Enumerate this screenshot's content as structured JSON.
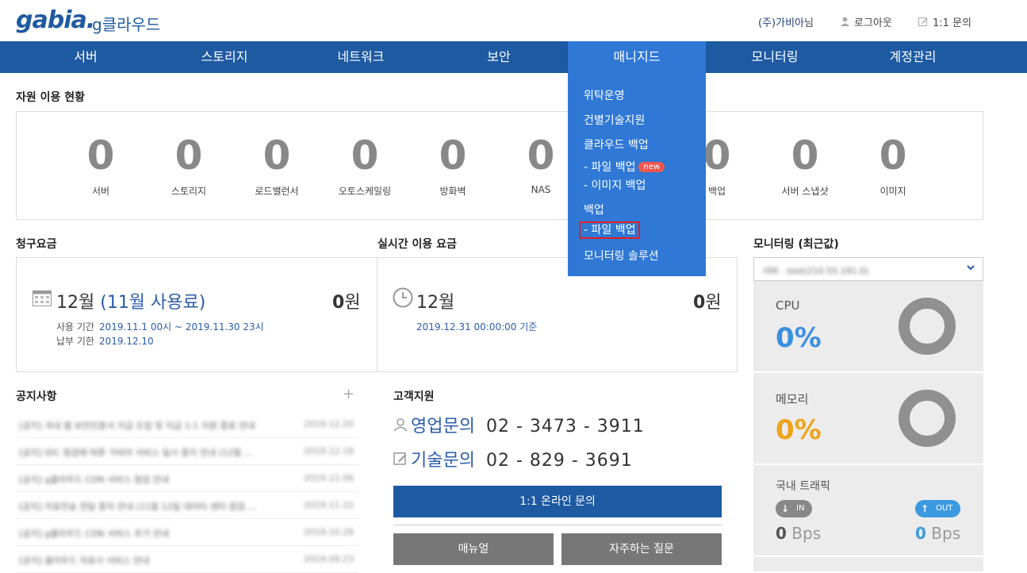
{
  "header": {
    "logo": "gabia.",
    "logo_sub": "g클라우드",
    "company": "(주)가비아",
    "company_suffix": "님",
    "logout": "로그아웃",
    "inquiry": "1:1 문의"
  },
  "nav": {
    "items": [
      "서버",
      "스토리지",
      "네트워크",
      "보안",
      "매니지드",
      "모니터링",
      "계정관리"
    ],
    "active_index": 4
  },
  "dropdown": {
    "items": [
      "위탁운영",
      "건별기술지원",
      "클라우드 백업",
      "- 파일 백업",
      "- 이미지 백업",
      "백업",
      "- 파일 백업",
      "모니터링 솔루션"
    ],
    "new_badge": "new",
    "highlighted_index": 6
  },
  "resources": {
    "title": "자원 이용 현황",
    "items": [
      {
        "count": "0",
        "label": "서버"
      },
      {
        "count": "0",
        "label": "스토리지"
      },
      {
        "count": "0",
        "label": "로드밸런서"
      },
      {
        "count": "0",
        "label": "오토스케일링"
      },
      {
        "count": "0",
        "label": "방화벽"
      },
      {
        "count": "0",
        "label": "NAS"
      },
      {
        "count": "0",
        "label": "백업"
      },
      {
        "count": "0",
        "label": "서버 스냅샷"
      },
      {
        "count": "0",
        "label": "이미지"
      }
    ]
  },
  "billing": {
    "title": "청구요금",
    "month": "12월",
    "usage_month": "(11월 사용료)",
    "amount": "0",
    "unit": "원",
    "period_label": "사용 기간",
    "period_value": "2019.11.1 00시 ~ 2019.11.30 23시",
    "due_label": "납부 기한",
    "due_value": "2019.12.10"
  },
  "realtime": {
    "title": "실시간 이용 요금",
    "month": "12월",
    "amount": "0",
    "unit": "원",
    "basis": "2019.12.31 00:00:00 기준"
  },
  "notices": {
    "title": "공지사항",
    "add_symbol": "+",
    "rows": [
      {
        "text": "[공지] 국내 웹 보안인증서 지급 도입 및 지급 1:1 지원 종료 안내",
        "date": "2019.12.20"
      },
      {
        "text": "[공지] IDC 점검에 따른 가비아 서비스 일시 중지 안내 (12월 ...",
        "date": "2019.12.18"
      },
      {
        "text": "[공지] g클라우드 CDN 서비스 점검 안내",
        "date": "2019.12.06"
      },
      {
        "text": "[공지] 자료전송 전달 중지 안내 (11월 12일 데이터 센터 점검 ...",
        "date": "2019.11.22"
      },
      {
        "text": "[공지] g클라우드 CDN 서비스 추가 안내",
        "date": "2019.10.28"
      },
      {
        "text": "[공지] 클라우드 자료사 서비스 안내",
        "date": "2019.09.23"
      }
    ]
  },
  "support": {
    "title": "고객지원",
    "sales_label": "영업문의",
    "sales_phone": "02 - 3473 - 3911",
    "tech_label": "기술문의",
    "tech_phone": "02 - 829 - 3691",
    "online_button": "1:1 온라인 문의",
    "manual_button": "매뉴얼",
    "faq_button": "자주하는 질문"
  },
  "monitoring": {
    "title": "모니터링 (최근값)",
    "selected_server": "서버 - test(210.55.191.0)",
    "cpu_label": "CPU",
    "cpu_value": "0%",
    "memory_label": "메모리",
    "memory_value": "0%",
    "traffic_label": "국내 트래픽",
    "in_label": "IN",
    "out_label": "OUT",
    "in_value": "0",
    "out_value": "0",
    "bps_unit": "Bps"
  },
  "colors": {
    "nav_bg": "#1d5aa2",
    "nav_active": "#2f78d5",
    "cpu_color": "#3b8fe0",
    "memory_color": "#f0a41c",
    "new_badge": "#f0564d"
  }
}
